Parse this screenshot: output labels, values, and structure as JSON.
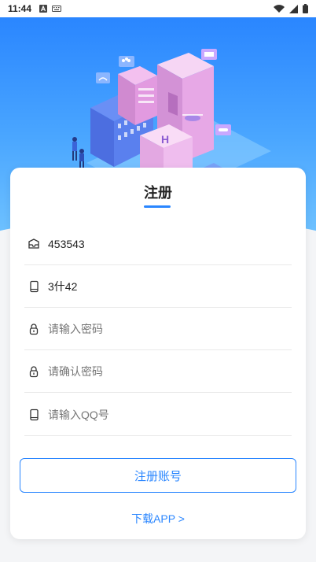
{
  "status_bar": {
    "time": "11:44",
    "left_icons": [
      "font-a-icon",
      "keyboard-icon"
    ],
    "right_icons": [
      "wifi-icon",
      "signal-icon",
      "battery-icon"
    ]
  },
  "hero": {
    "illustration": "isometric-city-illustration",
    "colors": {
      "top": "#2a86ff",
      "bottom": "#6fc2ff"
    }
  },
  "form": {
    "title": "注册",
    "accent_color": "#2a86ff",
    "fields": [
      {
        "icon": "envelope-icon",
        "value": "453543",
        "placeholder": ""
      },
      {
        "icon": "phone-icon",
        "value": "3什42",
        "placeholder": ""
      },
      {
        "icon": "lock-icon",
        "value": "",
        "placeholder": "请输入密码"
      },
      {
        "icon": "lock-icon",
        "value": "",
        "placeholder": "请确认密码"
      },
      {
        "icon": "phone-icon",
        "value": "",
        "placeholder": "请输入QQ号"
      }
    ],
    "submit_label": "注册账号",
    "download_link": "下载APP >"
  }
}
